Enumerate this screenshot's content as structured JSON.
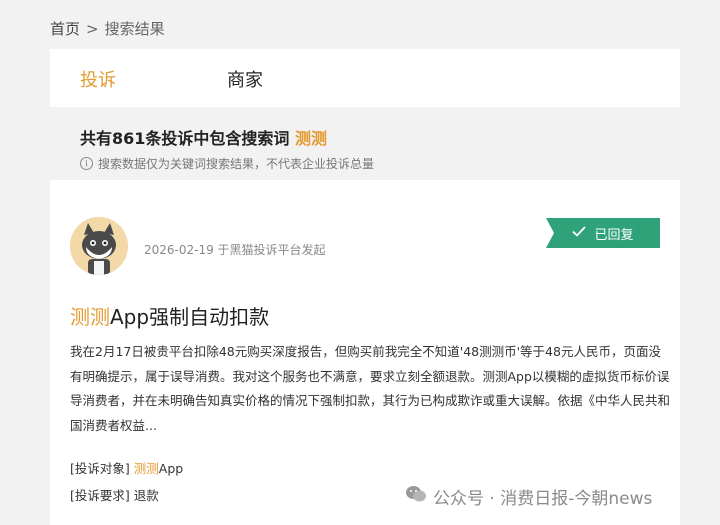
{
  "breadcrumb": {
    "home": "首页",
    "separator": ">",
    "current": "搜索结果"
  },
  "tabs": [
    {
      "label": "投诉",
      "active": true
    },
    {
      "label": "商家",
      "active": false
    }
  ],
  "summary": {
    "prefix": "共有861条投诉中包含搜索词",
    "keyword": "测测",
    "note": "搜索数据仅为关键词搜索结果，不代表企业投诉总量"
  },
  "complaint": {
    "avatar": "cat-avatar",
    "meta": "2026-02-19 于黑猫投诉平台发起",
    "status": "已回复",
    "status_color": "#2fa27a",
    "title_keyword": "测测",
    "title_rest": "App强制自动扣款",
    "body": "我在2月17日被贵平台扣除48元购买深度报告，但购买前我完全不知道'48测测币'等于48元人民币，页面没有明确提示，属于误导消费。我对这个服务也不满意，要求立刻全额退款。测测App以模糊的虚拟货币标价误导消费者，并在未明确告知真实价格的情况下强制扣款，其行为已构成欺诈或重大误解。依据《中华人民共和国消费者权益...",
    "target_label": "[投诉对象]",
    "target_keyword": "测测",
    "target_rest": "App",
    "request_label": "[投诉要求]",
    "request_value": "退款"
  },
  "watermark": {
    "text": "公众号 · 消费日报-今朝news",
    "icon": "wechat-icon"
  },
  "colors": {
    "accent": "#e39a2f",
    "status": "#2fa27a"
  }
}
